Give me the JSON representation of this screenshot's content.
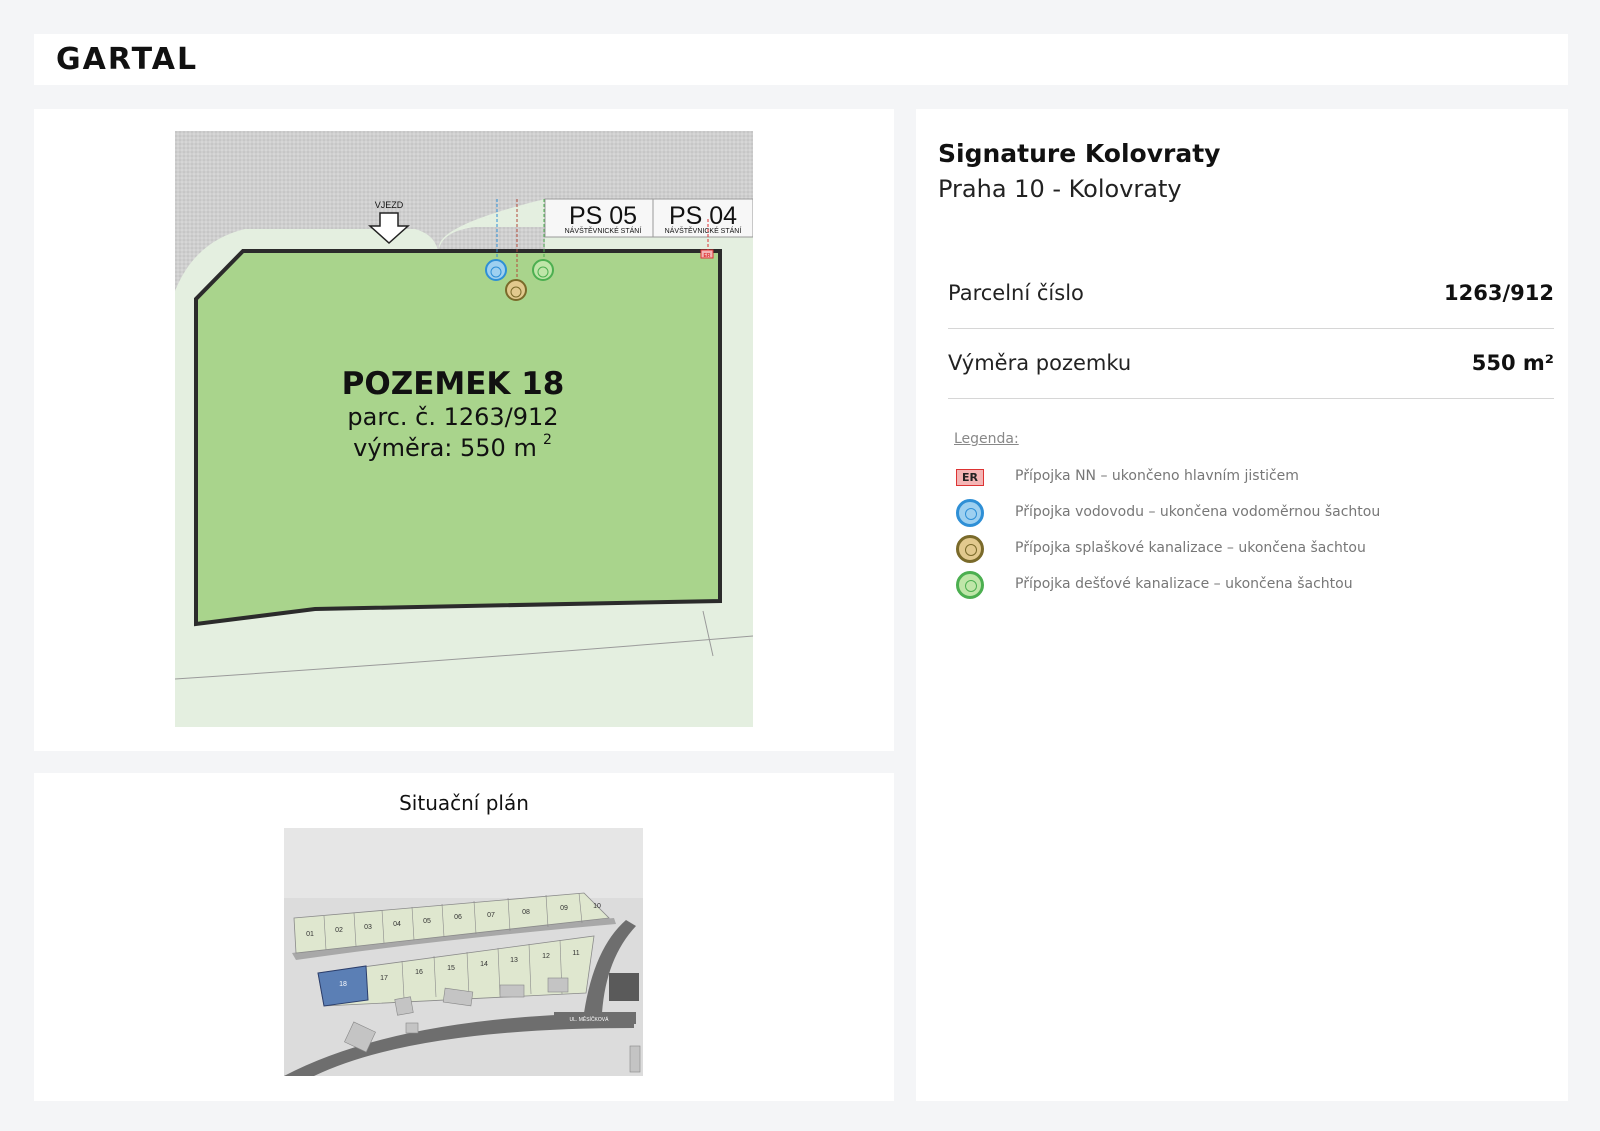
{
  "header": {
    "logo": "GARTAL"
  },
  "plot": {
    "title": "POZEMEK 18",
    "parcel_text": "parc. č. 1263/912",
    "area_text": "výměra: 550 m",
    "area_sup": "2",
    "entry_label": "VJEZD",
    "parking": [
      {
        "code": "PS 05",
        "sub": "NÁVŠTĚVNICKÉ STÁNÍ"
      },
      {
        "code": "PS 04",
        "sub": "NÁVŠTĚVNICKÉ STÁNÍ"
      }
    ],
    "er_tag": "ER"
  },
  "situation": {
    "title": "Situační plán",
    "street_label": "UL. MĚSÍČKOVÁ",
    "lots_top": [
      "01",
      "02",
      "03",
      "04",
      "05",
      "06",
      "07",
      "08",
      "09",
      "10"
    ],
    "lots_bottom": [
      "18",
      "17",
      "16",
      "15",
      "14",
      "13",
      "12",
      "11"
    ]
  },
  "project": {
    "name": "Signature Kolovraty",
    "location": "Praha 10 - Kolovraty"
  },
  "details": [
    {
      "label": "Parcelní číslo",
      "value": "1263/912"
    },
    {
      "label": "Výměra pozemku",
      "value": "550 m²"
    }
  ],
  "legend": {
    "title": "Legenda:",
    "items": [
      {
        "symbol": "er-box",
        "tag": "ER",
        "text": "Přípojka NN – ukončeno hlavním jističem",
        "color": "#d33333"
      },
      {
        "symbol": "circle",
        "text": "Přípojka vodovodu – ukončena vodoměrnou šachtou",
        "color": "#2e8fd6"
      },
      {
        "symbol": "circle",
        "text": "Přípojka splaškové kanalizace – ukončena šachtou",
        "color": "#7a6a2a"
      },
      {
        "symbol": "circle",
        "text": "Přípojka dešťové kanalizace – ukončena šachtou",
        "color": "#4caf50"
      }
    ]
  },
  "colors": {
    "plot_fill": "#a9d48c",
    "lot_fill": "#dfe7cf",
    "selected_lot": "#5b7fb5",
    "road": "#6e6e6e"
  }
}
